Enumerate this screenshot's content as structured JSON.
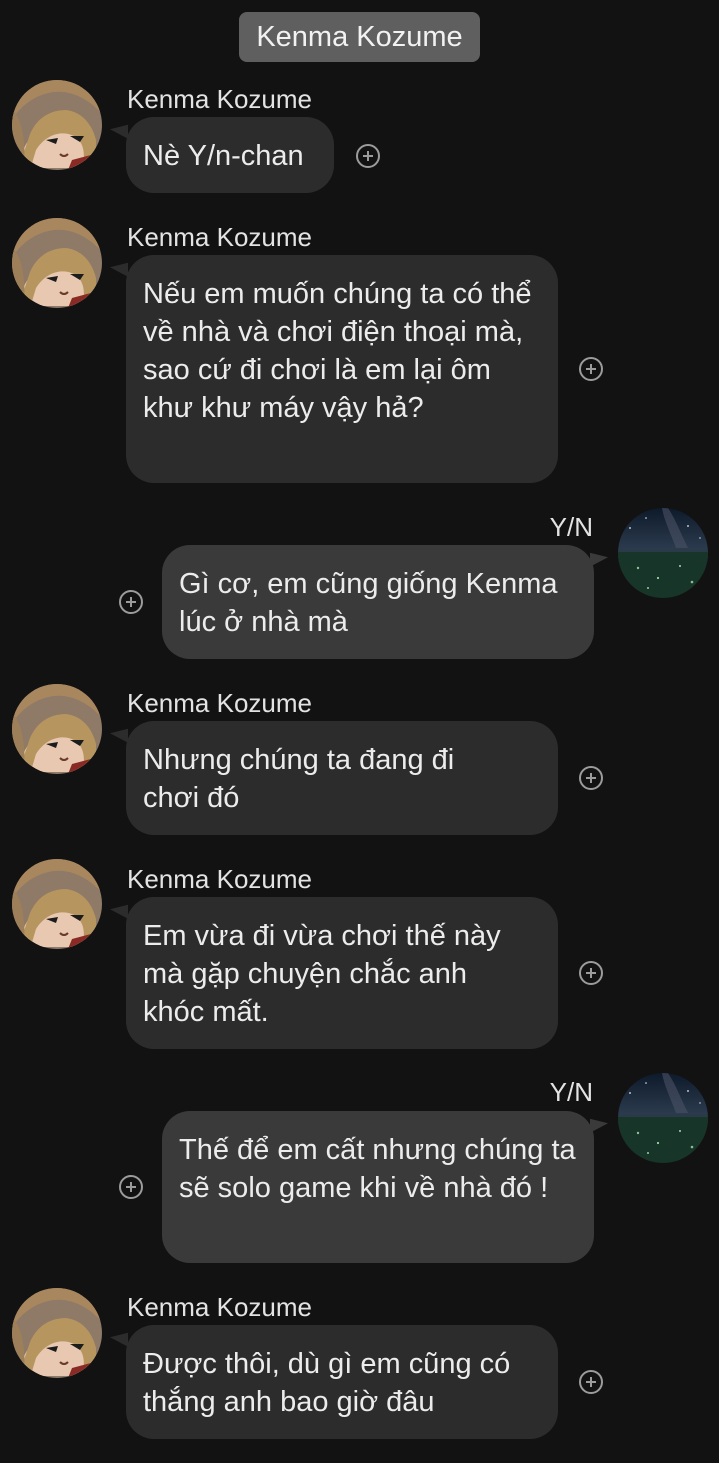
{
  "chat": {
    "title": "Kenma Kozume"
  },
  "messages": [
    {
      "sender": "Kenma Kozume",
      "direction": "incoming",
      "text": "Nè Y/n-chan"
    },
    {
      "sender": "Kenma Kozume",
      "direction": "incoming",
      "text": "Nếu em muốn chúng ta có thể về nhà và chơi điện thoại mà, sao cứ đi chơi là em lại ôm khư khư máy vậy hả?"
    },
    {
      "sender": "Y/N",
      "direction": "outgoing",
      "text": "Gì cơ, em cũng giống Kenma lúc ở nhà mà"
    },
    {
      "sender": "Kenma Kozume",
      "direction": "incoming",
      "text": "Nhưng chúng ta đang đi chơi đó"
    },
    {
      "sender": "Kenma Kozume",
      "direction": "incoming",
      "text": "Em vừa đi vừa chơi thế này mà gặp chuyện chắc anh khóc mất."
    },
    {
      "sender": "Y/N",
      "direction": "outgoing",
      "text": "Thế để em cất nhưng chúng ta sẽ solo game khi về nhà đó !"
    },
    {
      "sender": "Kenma Kozume",
      "direction": "incoming",
      "text": "Được thôi, dù gì em cũng có thắng anh bao giờ đâu"
    }
  ],
  "icons": {
    "reaction": "add-reaction-icon",
    "kenma_avatar": "kenma-avatar",
    "yn_avatar": "starry-field-avatar"
  },
  "colors": {
    "background": "#121212",
    "incoming_bubble": "#2c2c2c",
    "outgoing_bubble": "#3a3a3a",
    "title_pill": "#5f5f5f"
  }
}
